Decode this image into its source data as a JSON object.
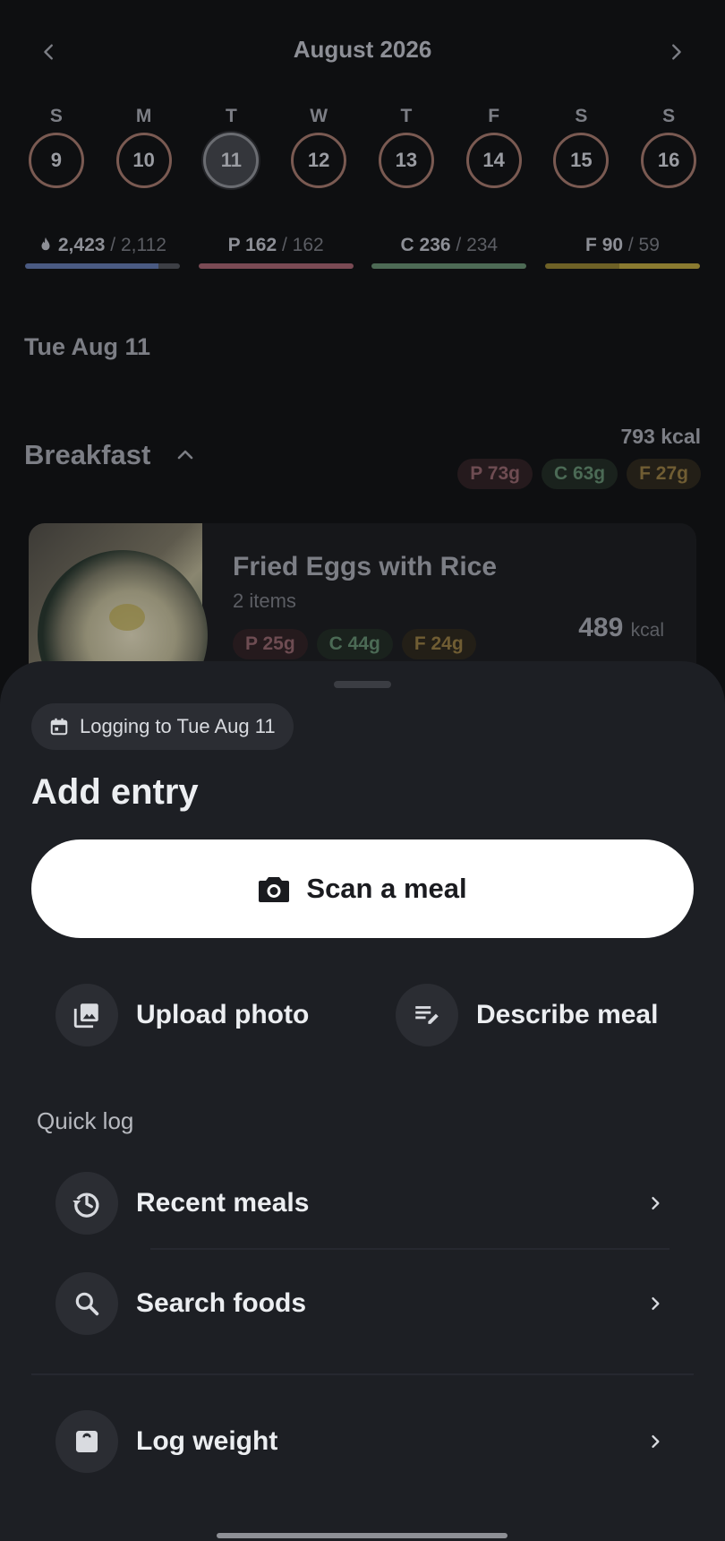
{
  "calendar": {
    "month_title": "August 2026",
    "days": [
      {
        "dow": "S",
        "num": "9"
      },
      {
        "dow": "M",
        "num": "10"
      },
      {
        "dow": "T",
        "num": "11",
        "selected": true
      },
      {
        "dow": "W",
        "num": "12"
      },
      {
        "dow": "T",
        "num": "13"
      },
      {
        "dow": "F",
        "num": "14"
      },
      {
        "dow": "S",
        "num": "15"
      },
      {
        "dow": "S",
        "num": "16"
      }
    ]
  },
  "macros": {
    "calories": {
      "value": "2,423",
      "goal": "/ 2,112",
      "progress": 0.86,
      "color": "#4a5a82",
      "track": "#3d3f45"
    },
    "protein": {
      "label": "P",
      "value": "162",
      "goal": "/ 162",
      "progress": 1.0,
      "color": "#7a4a54"
    },
    "carbs": {
      "label": "C",
      "value": "236",
      "goal": "/ 234",
      "progress": 1.0,
      "color": "#4d6a55"
    },
    "fat": {
      "label": "F",
      "value": "90",
      "goal": "/ 59",
      "progress": 1.0,
      "color": "#6e6126",
      "over_color": "#8a7a30"
    }
  },
  "date_heading": "Tue Aug 11",
  "meal": {
    "title": "Breakfast",
    "kcal": "793 kcal",
    "pills": {
      "p": "P 73g",
      "c": "C 63g",
      "f": "F 27g"
    },
    "item": {
      "name": "Fried Eggs with Rice",
      "subtitle": "2 items",
      "pills": {
        "p": "P 25g",
        "c": "C 44g",
        "f": "F 24g"
      },
      "kcal_value": "489",
      "kcal_unit": "kcal"
    }
  },
  "sheet": {
    "logging_chip": "Logging to Tue Aug 11",
    "title": "Add entry",
    "scan_label": "Scan a meal",
    "upload_label": "Upload photo",
    "describe_label": "Describe meal",
    "quick_log_label": "Quick log",
    "recent_label": "Recent meals",
    "search_label": "Search foods",
    "weight_label": "Log weight"
  },
  "icons": {
    "prev_month": "chevron-left-icon",
    "next_month": "chevron-right-icon",
    "calories": "flame-icon",
    "meal_toggle": "chevron-up-icon",
    "chip": "calendar-icon",
    "scan": "camera-icon",
    "upload": "photo-library-icon",
    "describe": "edit-note-icon",
    "recent": "history-icon",
    "search": "search-icon",
    "weight": "scale-icon"
  }
}
